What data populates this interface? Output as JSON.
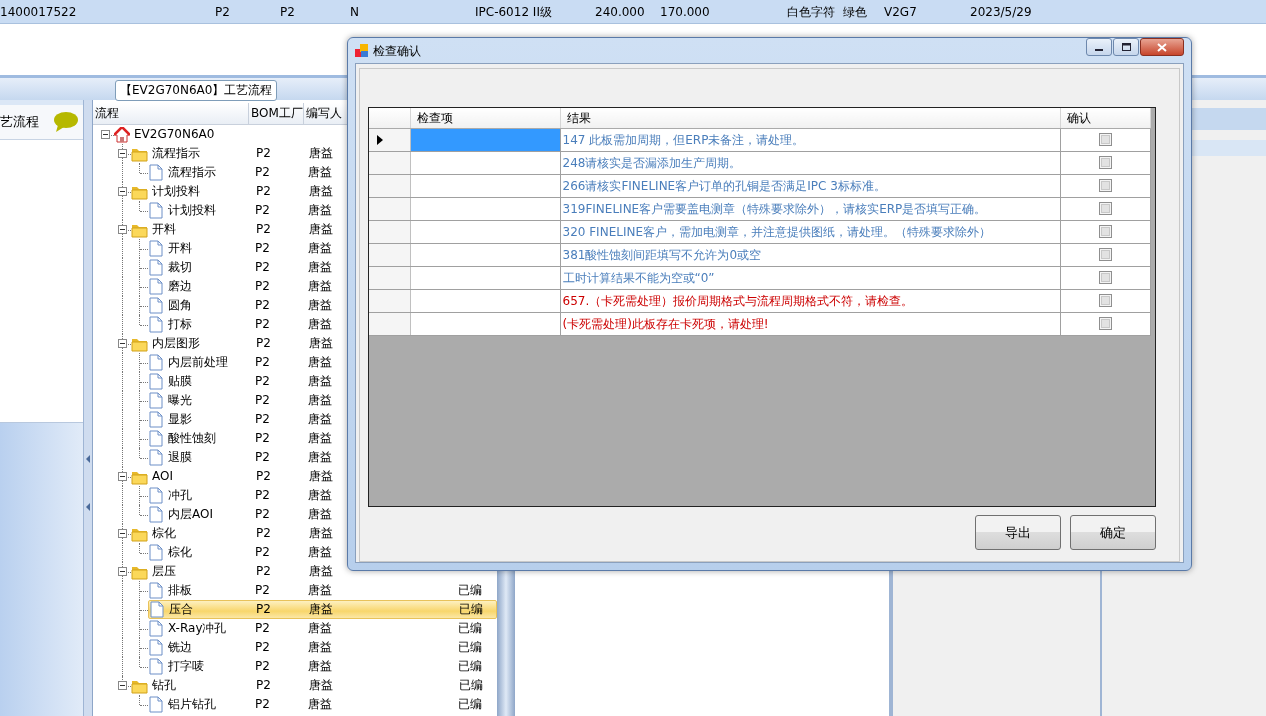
{
  "record_bar": {
    "cells": [
      "1400017522",
      "P2",
      "P2",
      "N",
      "IPC-6012 II级",
      "240.000",
      "170.000",
      "白色字符",
      "绿色",
      "V2G7",
      "2023/5/29"
    ]
  },
  "process_tab": {
    "label": "【EV2G70N6A0】工艺流程"
  },
  "left_panel": {
    "title": "艺流程"
  },
  "tree_grid": {
    "columns": [
      "流程",
      "BOM工厂",
      "编写人"
    ],
    "root": {
      "label": "EV2G70N6A0",
      "expanded": true,
      "selected": false,
      "children": [
        {
          "label": "流程指示",
          "factory": "P2",
          "author": "唐益",
          "expanded": true,
          "selected": false,
          "children": [
            {
              "label": "流程指示",
              "factory": "P2",
              "author": "唐益",
              "selected": false
            }
          ]
        },
        {
          "label": "计划投料",
          "factory": "P2",
          "author": "唐益",
          "expanded": true,
          "selected": false,
          "children": [
            {
              "label": "计划投料",
              "factory": "P2",
              "author": "唐益",
              "selected": false
            }
          ]
        },
        {
          "label": "开料",
          "factory": "P2",
          "author": "唐益",
          "expanded": true,
          "selected": false,
          "children": [
            {
              "label": "开料",
              "factory": "P2",
              "author": "唐益",
              "selected": false
            },
            {
              "label": "裁切",
              "factory": "P2",
              "author": "唐益",
              "selected": false
            },
            {
              "label": "磨边",
              "factory": "P2",
              "author": "唐益",
              "selected": false
            },
            {
              "label": "圆角",
              "factory": "P2",
              "author": "唐益",
              "selected": false
            },
            {
              "label": "打标",
              "factory": "P2",
              "author": "唐益",
              "selected": false
            }
          ]
        },
        {
          "label": "内层图形",
          "factory": "P2",
          "author": "唐益",
          "expanded": true,
          "selected": false,
          "children": [
            {
              "label": "内层前处理",
              "factory": "P2",
              "author": "唐益",
              "selected": false
            },
            {
              "label": "贴膜",
              "factory": "P2",
              "author": "唐益",
              "selected": false
            },
            {
              "label": "曝光",
              "factory": "P2",
              "author": "唐益",
              "selected": false
            },
            {
              "label": "显影",
              "factory": "P2",
              "author": "唐益",
              "selected": false
            },
            {
              "label": "酸性蚀刻",
              "factory": "P2",
              "author": "唐益",
              "selected": false
            },
            {
              "label": "退膜",
              "factory": "P2",
              "author": "唐益",
              "selected": false
            }
          ]
        },
        {
          "label": "AOI",
          "factory": "P2",
          "author": "唐益",
          "expanded": true,
          "selected": false,
          "children": [
            {
              "label": "冲孔",
              "factory": "P2",
              "author": "唐益",
              "selected": false
            },
            {
              "label": "内层AOI",
              "factory": "P2",
              "author": "唐益",
              "selected": false
            }
          ]
        },
        {
          "label": "棕化",
          "factory": "P2",
          "author": "唐益",
          "expanded": true,
          "selected": false,
          "children": [
            {
              "label": "棕化",
              "factory": "P2",
              "author": "唐益",
              "selected": false
            }
          ]
        },
        {
          "label": "层压",
          "factory": "P2",
          "author": "唐益",
          "expanded": true,
          "selected": false,
          "children": [
            {
              "label": "排板",
              "factory": "P2",
              "author": "唐益",
              "status": "已编",
              "selected": false
            },
            {
              "label": "压合",
              "factory": "P2",
              "author": "唐益",
              "status": "已编",
              "selected": true
            },
            {
              "label": "X-Ray冲孔",
              "factory": "P2",
              "author": "唐益",
              "status": "已编",
              "selected": false
            },
            {
              "label": "铣边",
              "factory": "P2",
              "author": "唐益",
              "status": "已编",
              "selected": false
            },
            {
              "label": "打字唛",
              "factory": "P2",
              "author": "唐益",
              "status": "已编",
              "selected": false
            }
          ]
        },
        {
          "label": "钻孔",
          "factory": "P2",
          "author": "唐益",
          "status": "已编",
          "expanded": true,
          "selected": false,
          "children": [
            {
              "label": "铝片钻孔",
              "factory": "P2",
              "author": "唐益",
              "status": "已编",
              "selected": false
            }
          ]
        }
      ]
    }
  },
  "dialog": {
    "title": "检查确认",
    "columns": [
      "检查项",
      "结果",
      "确认"
    ],
    "rows": [
      {
        "result": "147 此板需加周期，但ERP未备注，请处理。",
        "color": "#4a7ebb",
        "confirmed": false,
        "selected": true
      },
      {
        "result": "248请核实是否漏添加生产周期。",
        "color": "#4a7ebb",
        "confirmed": false,
        "selected": false
      },
      {
        "result": "266请核实FINELINE客户订单的孔铜是否满足IPC 3标标准。",
        "color": "#4a7ebb",
        "confirmed": false,
        "selected": false
      },
      {
        "result": "319FINELINE客户需要盖电测章（特殊要求除外），请核实ERP是否填写正确。",
        "color": "#4a7ebb",
        "confirmed": false,
        "selected": false
      },
      {
        "result": "320 FINELINE客户，需加电测章，并注意提供图纸，请处理。（特殊要求除外）",
        "color": "#4a7ebb",
        "confirmed": false,
        "selected": false
      },
      {
        "result": "381酸性蚀刻间距填写不允许为0或空",
        "color": "#4a7ebb",
        "confirmed": false,
        "selected": false
      },
      {
        "result": "工时计算结果不能为空或“0”",
        "color": "#4a7ebb",
        "confirmed": false,
        "selected": false
      },
      {
        "result": "657.（卡死需处理）报价周期格式与流程周期格式不符，请检查。",
        "color": "#cc0000",
        "confirmed": false,
        "selected": false
      },
      {
        "result": "(卡死需处理)此板存在卡死项，请处理!",
        "color": "#cc0000",
        "confirmed": false,
        "selected": false
      }
    ],
    "buttons": [
      "导出",
      "确定"
    ]
  }
}
